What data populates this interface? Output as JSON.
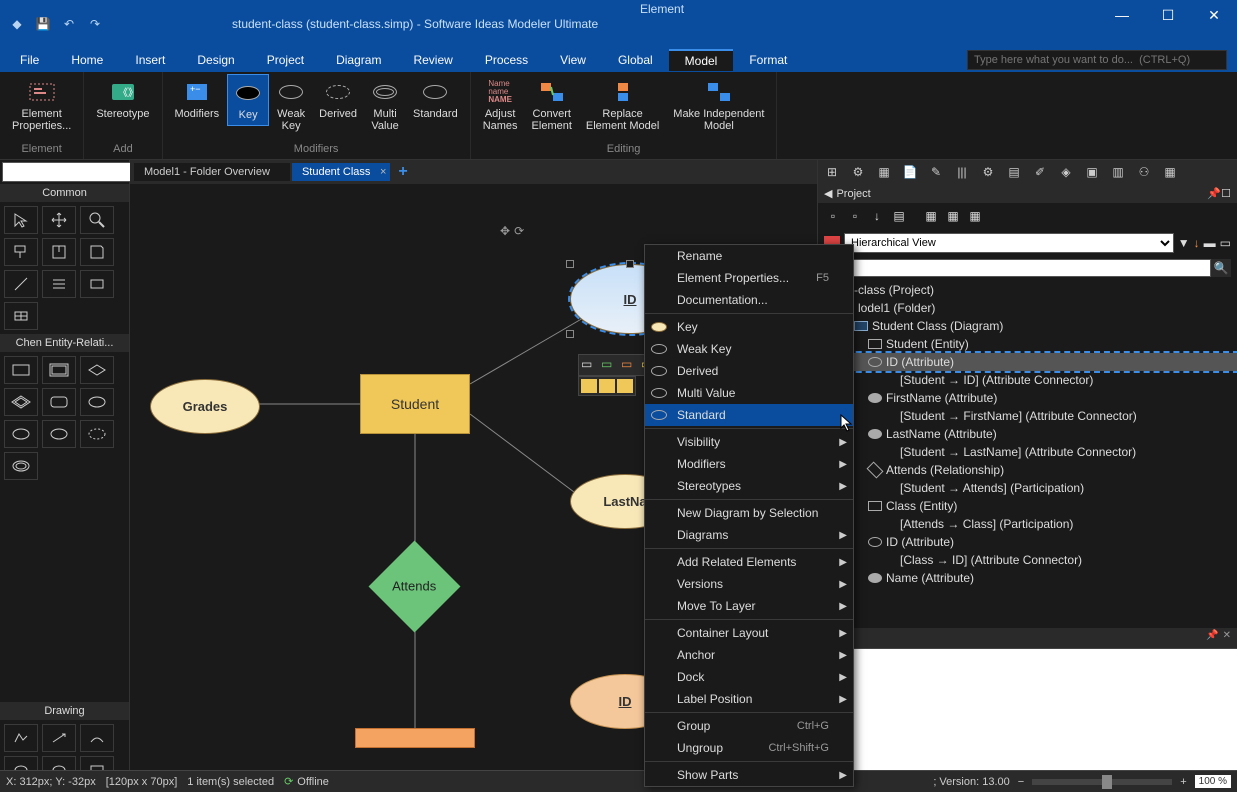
{
  "window": {
    "title": "student-class (student-class.simp)  -  Software Ideas Modeler Ultimate",
    "context_tab": "Element"
  },
  "menu": {
    "items": [
      "File",
      "Home",
      "Insert",
      "Design",
      "Project",
      "Diagram",
      "Review",
      "Process",
      "View",
      "Global",
      "Model",
      "Format"
    ],
    "active": "Model",
    "search_placeholder": "Type here what you want to do...  (CTRL+Q)"
  },
  "ribbon": {
    "groups": [
      {
        "label": "Element",
        "items": [
          {
            "label": "Element\nProperties..."
          }
        ]
      },
      {
        "label": "Add",
        "items": [
          {
            "label": "Stereotype"
          }
        ]
      },
      {
        "label": "Modifiers",
        "items": [
          {
            "label": "Modifiers"
          },
          {
            "label": "Key",
            "active": true
          },
          {
            "label": "Weak\nKey"
          },
          {
            "label": "Derived"
          },
          {
            "label": "Multi\nValue"
          },
          {
            "label": "Standard"
          }
        ]
      },
      {
        "label": "Editing",
        "items": [
          {
            "label": "Adjust\nNames"
          },
          {
            "label": "Convert\nElement"
          },
          {
            "label": "Replace\nElement Model"
          },
          {
            "label": "Make Independent\nModel"
          }
        ]
      }
    ]
  },
  "tabs": {
    "items": [
      {
        "label": "Model1 - Folder Overview",
        "active": false
      },
      {
        "label": "Student Class",
        "active": true
      }
    ]
  },
  "left_panels": {
    "common": "Common",
    "chen": "Chen Entity-Relati...",
    "drawing": "Drawing"
  },
  "canvas": {
    "entities": {
      "grades": "Grades",
      "student": "Student",
      "id": "ID",
      "lastname": "LastNa",
      "attends": "Attends",
      "id2": "ID"
    }
  },
  "context_menu": {
    "items": [
      {
        "label": "Rename",
        "type": "item"
      },
      {
        "label": "Element Properties...",
        "shortcut": "F5",
        "type": "item"
      },
      {
        "label": "Documentation...",
        "type": "item"
      },
      {
        "type": "sep"
      },
      {
        "label": "Key",
        "type": "item",
        "icon": "ellipse-key"
      },
      {
        "label": "Weak Key",
        "type": "item",
        "icon": "ellipse"
      },
      {
        "label": "Derived",
        "type": "item",
        "icon": "ellipse"
      },
      {
        "label": "Multi Value",
        "type": "item",
        "icon": "ellipse"
      },
      {
        "label": "Standard",
        "type": "item",
        "icon": "ellipse",
        "highlighted": true
      },
      {
        "type": "sep"
      },
      {
        "label": "Visibility",
        "type": "submenu"
      },
      {
        "label": "Modifiers",
        "type": "submenu"
      },
      {
        "label": "Stereotypes",
        "type": "submenu"
      },
      {
        "type": "sep"
      },
      {
        "label": "New Diagram by Selection",
        "type": "item"
      },
      {
        "label": "Diagrams",
        "type": "submenu"
      },
      {
        "type": "sep"
      },
      {
        "label": "Add Related Elements",
        "type": "submenu"
      },
      {
        "label": "Versions",
        "type": "submenu"
      },
      {
        "label": "Move To Layer",
        "type": "submenu"
      },
      {
        "type": "sep"
      },
      {
        "label": "Container Layout",
        "type": "submenu"
      },
      {
        "label": "Anchor",
        "type": "submenu"
      },
      {
        "label": "Dock",
        "type": "submenu"
      },
      {
        "label": "Label Position",
        "type": "submenu"
      },
      {
        "type": "sep"
      },
      {
        "label": "Group",
        "shortcut": "Ctrl+G",
        "type": "item"
      },
      {
        "label": "Ungroup",
        "shortcut": "Ctrl+Shift+G",
        "type": "item"
      },
      {
        "type": "sep"
      },
      {
        "label": "Show Parts",
        "type": "submenu"
      }
    ]
  },
  "project": {
    "header": "Project",
    "view_mode": "Hierarchical View",
    "tree": [
      {
        "label": "nt-class (Project)",
        "indent": 0,
        "icon": "folder"
      },
      {
        "label": "lodel1 (Folder)",
        "indent": 1,
        "icon": "folder"
      },
      {
        "label": "Student Class (Diagram)",
        "indent": 2,
        "icon": "diagram"
      },
      {
        "label": "Student (Entity)",
        "indent": 3,
        "icon": "rect"
      },
      {
        "label": "ID (Attribute)",
        "indent": 3,
        "icon": "ellipse",
        "selected": true
      },
      {
        "label": "[Student → ID] (Attribute Connector)",
        "indent": 4,
        "icon": "line"
      },
      {
        "label": "FirstName (Attribute)",
        "indent": 3,
        "icon": "ellipse-filled"
      },
      {
        "label": "[Student → FirstName] (Attribute Connector)",
        "indent": 4,
        "icon": "line"
      },
      {
        "label": "LastName (Attribute)",
        "indent": 3,
        "icon": "ellipse-filled"
      },
      {
        "label": "[Student → LastName] (Attribute Connector)",
        "indent": 4,
        "icon": "line"
      },
      {
        "label": "Attends (Relationship)",
        "indent": 3,
        "icon": "diamond"
      },
      {
        "label": "[Student → Attends] (Participation)",
        "indent": 4,
        "icon": "line"
      },
      {
        "label": "Class (Entity)",
        "indent": 3,
        "icon": "rect"
      },
      {
        "label": "[Attends → Class] (Participation)",
        "indent": 4,
        "icon": "line"
      },
      {
        "label": "ID (Attribute)",
        "indent": 3,
        "icon": "ellipse"
      },
      {
        "label": "[Class → ID] (Attribute Connector)",
        "indent": 4,
        "icon": "line"
      },
      {
        "label": "Name (Attribute)",
        "indent": 3,
        "icon": "ellipse-filled"
      }
    ]
  },
  "status": {
    "coords": "X: 312px; Y: -32px",
    "size": "[120px x 70px]",
    "selection": "1 item(s) selected",
    "offline": "Offline",
    "version": "; Version: 13.00",
    "zoom": "100 %"
  }
}
